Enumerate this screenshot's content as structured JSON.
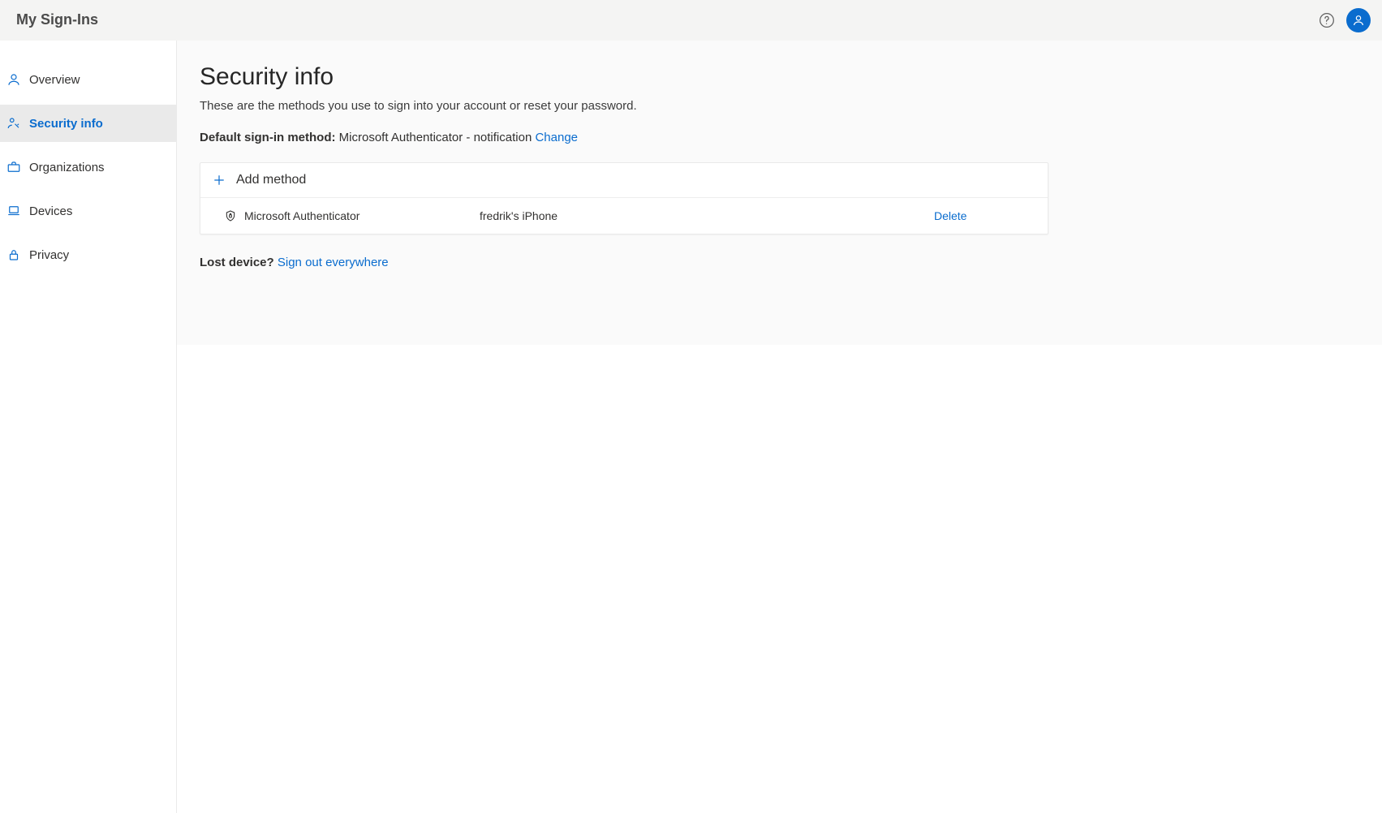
{
  "header": {
    "app_title": "My Sign-Ins"
  },
  "sidebar": {
    "items": [
      {
        "label": "Overview"
      },
      {
        "label": "Security info"
      },
      {
        "label": "Organizations"
      },
      {
        "label": "Devices"
      },
      {
        "label": "Privacy"
      }
    ],
    "active_index": 1
  },
  "main": {
    "title": "Security info",
    "subtitle": "These are the methods you use to sign into your account or reset your password.",
    "default_method": {
      "label": "Default sign-in method:",
      "value": "Microsoft Authenticator - notification",
      "change_label": "Change"
    },
    "add_method_label": "Add method",
    "methods": [
      {
        "name": "Microsoft Authenticator",
        "device": "fredrik's iPhone",
        "action_label": "Delete"
      }
    ],
    "lost_device": {
      "label": "Lost device?",
      "action_label": "Sign out everywhere"
    }
  },
  "colors": {
    "accent": "#0a6cce",
    "topbar_bg": "#f4f4f3",
    "sidebar_active_bg": "#eaeaea",
    "main_bg": "#fafafa"
  }
}
